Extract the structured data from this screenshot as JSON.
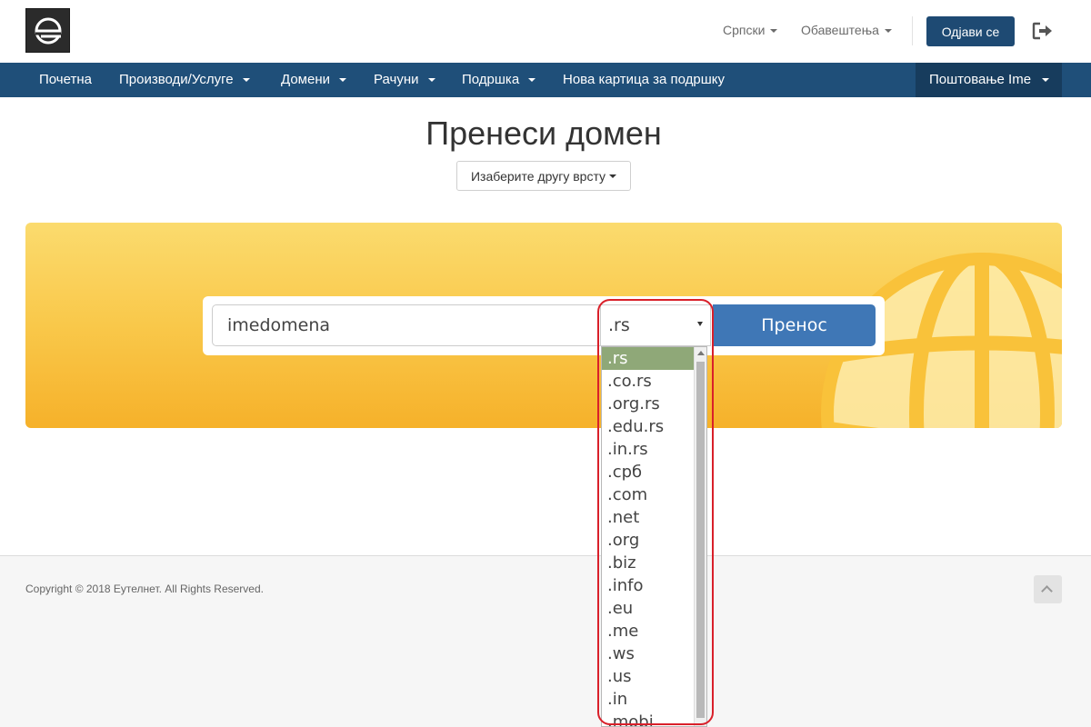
{
  "header": {
    "language_label": "Српски",
    "notifications_label": "Обавештења",
    "logout_label": "Одјави се"
  },
  "nav": {
    "items": [
      {
        "label": "Почетна",
        "dropdown": false
      },
      {
        "label": "Производи/Услуге",
        "dropdown": true
      },
      {
        "label": "Домени",
        "dropdown": true
      },
      {
        "label": "Рачуни",
        "dropdown": true
      },
      {
        "label": "Подршка",
        "dropdown": true
      },
      {
        "label": "Нова картица за подршку",
        "dropdown": false
      }
    ],
    "user_label": "Поштовање Ime"
  },
  "main": {
    "title": "Пренеси домен",
    "choose_type_label": "Изаберите другу врсту"
  },
  "search": {
    "domain_value": "imedomena",
    "tld_selected": ".rs",
    "transfer_label": "Пренос"
  },
  "tld_options": [
    ".rs",
    ".co.rs",
    ".org.rs",
    ".edu.rs",
    ".in.rs",
    ".срб",
    ".com",
    ".net",
    ".org",
    ".biz",
    ".info",
    ".eu",
    ".me",
    ".ws",
    ".us",
    ".in",
    ".mobi"
  ],
  "footer": {
    "copyright": "Copyright © 2018 Еутелнет. All Rights Reserved."
  },
  "colors": {
    "navbar": "#1f4f79",
    "accent_button": "#3f77b6",
    "banner_yellow": "#f9c84a",
    "selected_option": "#8fa878",
    "highlight": "#d9202a"
  }
}
